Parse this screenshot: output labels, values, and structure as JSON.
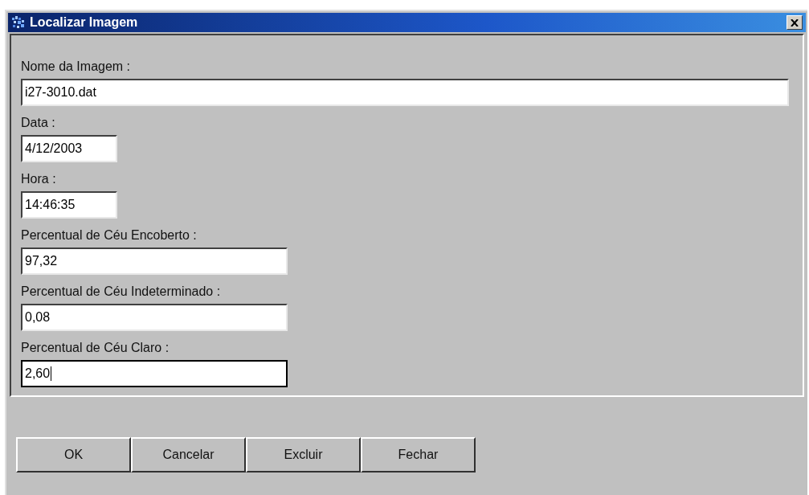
{
  "window": {
    "title": "Localizar Imagem"
  },
  "fields": [
    {
      "label": "Nome da Imagem :",
      "value": "i27-3010.dat",
      "kind": "long",
      "focused": false
    },
    {
      "label": "Data :",
      "value": "4/12/2003",
      "kind": "short",
      "focused": false
    },
    {
      "label": "Hora :",
      "value": "14:46:35",
      "kind": "short",
      "focused": false
    },
    {
      "label": "Percentual de Céu Encoberto  :",
      "value": "97,32",
      "kind": "medium",
      "focused": false
    },
    {
      "label": "Percentual de Céu Indeterminado :",
      "value": "0,08",
      "kind": "medium",
      "focused": false
    },
    {
      "label": "Percentual de Céu Claro :",
      "value": "2,60",
      "kind": "medium",
      "focused": true
    }
  ],
  "buttons": [
    "OK",
    "Cancelar",
    "Excluir",
    "Fechar"
  ]
}
